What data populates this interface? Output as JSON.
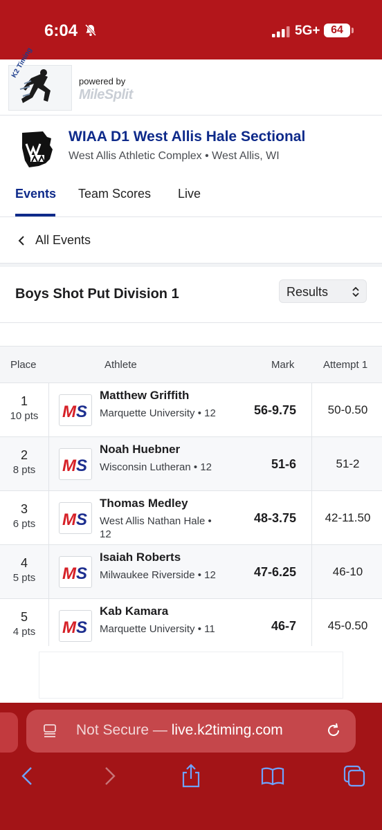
{
  "status": {
    "time": "6:04",
    "network": "5G+",
    "battery": "64"
  },
  "timer": {
    "logo_text": "K2 Timing",
    "powered_by": "powered by",
    "brand": "MileSplit"
  },
  "meet": {
    "title": "WIAA D1 West Allis Hale Sectional",
    "location": "West Allis Athletic Complex • West Allis, WI"
  },
  "tabs": [
    {
      "label": "Events",
      "active": true
    },
    {
      "label": "Team Scores",
      "active": false
    },
    {
      "label": "Live",
      "active": false
    }
  ],
  "nav": {
    "all_events": "All Events"
  },
  "event": {
    "title": "Boys Shot Put Division 1",
    "view_select": "Results"
  },
  "table": {
    "headers": {
      "place": "Place",
      "athlete": "Athlete",
      "mark": "Mark",
      "attempt1": "Attempt 1"
    },
    "rows": [
      {
        "place": "1",
        "pts": "10 pts",
        "name": "Matthew Griffith",
        "team": "Marquette University • 12",
        "mark": "56-9.75",
        "attempt1": "50-0.50"
      },
      {
        "place": "2",
        "pts": "8 pts",
        "name": "Noah Huebner",
        "team": "Wisconsin Lutheran • 12",
        "mark": "51-6",
        "attempt1": "51-2"
      },
      {
        "place": "3",
        "pts": "6 pts",
        "name": "Thomas Medley",
        "team": "West Allis Nathan Hale • 12",
        "mark": "48-3.75",
        "attempt1": "42-11.50"
      },
      {
        "place": "4",
        "pts": "5 pts",
        "name": "Isaiah Roberts",
        "team": "Milwaukee Riverside • 12",
        "mark": "47-6.25",
        "attempt1": "46-10"
      },
      {
        "place": "5",
        "pts": "4 pts",
        "name": "Kab Kamara",
        "team": "Marquette University • 11",
        "mark": "46-7",
        "attempt1": "45-0.50"
      }
    ]
  },
  "browser": {
    "security": "Not Secure — ",
    "domain": "live.k2timing.com"
  },
  "colors": {
    "brand_red": "#b3161b",
    "link_blue": "#0e2a8a",
    "ms_red": "#d62027",
    "ms_blue": "#1d2f8f"
  },
  "icons": [
    "bell-slash-icon",
    "signal-icon",
    "back-chevron-icon",
    "select-arrows-icon",
    "reader-icon",
    "reload-icon",
    "back-icon",
    "forward-icon",
    "share-icon",
    "bookmarks-icon",
    "tabs-icon"
  ]
}
